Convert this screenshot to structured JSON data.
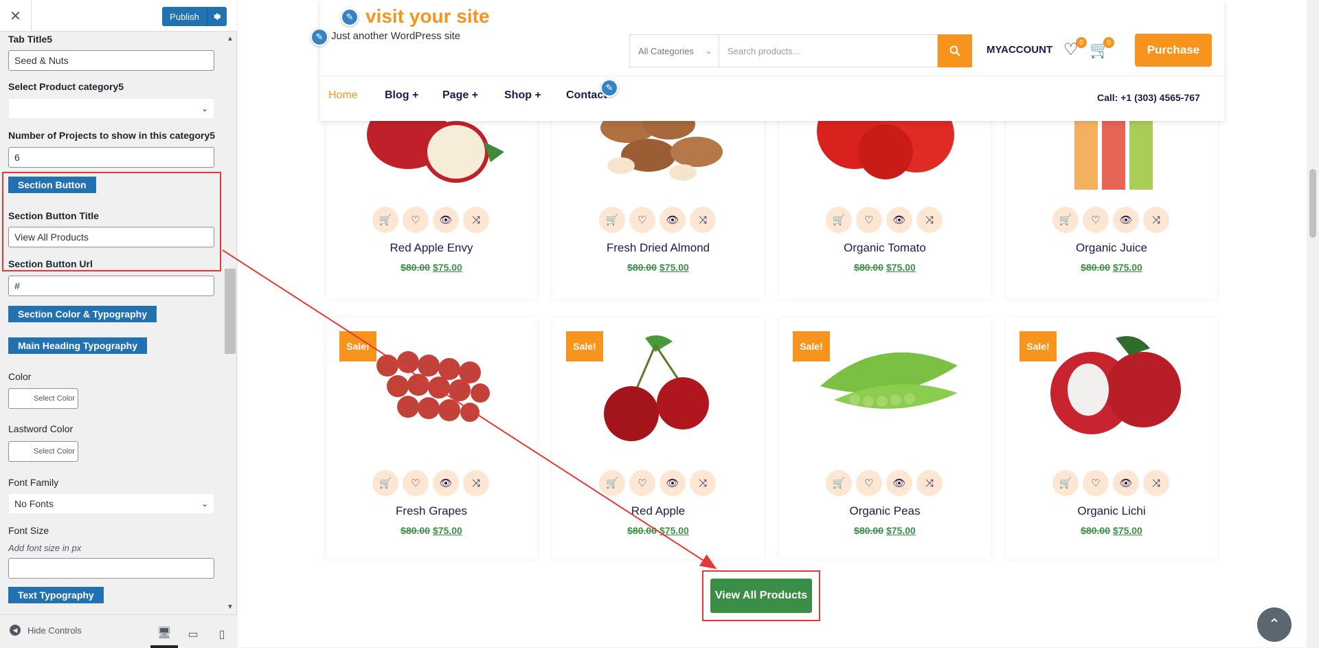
{
  "customizer": {
    "close_glyph": "✕",
    "publish_label": "Publish",
    "tab_title_label": "Tab Title5",
    "tab_title_value": "Seed & Nuts",
    "product_category_label": "Select Product category5",
    "product_category_value": "",
    "projects_count_label": "Number of Projects to show in this category5",
    "projects_count_value": "6",
    "section_button_heading": "Section Button",
    "button_title_label": "Section Button Title",
    "button_title_value": "View All Products",
    "button_url_label": "Section Button Url",
    "button_url_value": "#",
    "color_typography_heading": "Section Color & Typography",
    "main_heading_typography": "Main Heading Typography",
    "color_label": "Color",
    "color_button": "Select Color",
    "lastword_color_label": "Lastword Color",
    "lastword_color_button": "Select Color",
    "font_family_label": "Font Family",
    "font_family_value": "No Fonts",
    "font_size_label": "Font Size",
    "font_size_note": "Add font size in px",
    "font_size_value": "",
    "text_typography_heading": "Text Typography",
    "hide_controls": "Hide Controls"
  },
  "site": {
    "title": "visit your site",
    "tagline": "Just another WordPress site",
    "category_select": "All Categories",
    "search_placeholder": "Search products...",
    "my_account": "MYACCOUNT",
    "wishlist_count": "0",
    "cart_count": "0",
    "purchase": "Purchase",
    "nav": [
      "Home",
      "Blog +",
      "Page +",
      "Shop +",
      "Contact"
    ],
    "call": "Call: +1 (303) 4565-767"
  },
  "products_top": [
    {
      "name": "Red Apple Envy",
      "old": "$80.00",
      "new": "$75.00"
    },
    {
      "name": "Fresh Dried Almond",
      "old": "$80.00",
      "new": "$75.00"
    },
    {
      "name": "Organic Tomato",
      "old": "$80.00",
      "new": "$75.00"
    },
    {
      "name": "Organic Juice",
      "old": "$80.00",
      "new": "$75.00"
    }
  ],
  "products_bottom": [
    {
      "name": "Fresh Grapes",
      "old": "$80.00",
      "new": "$75.00",
      "sale": "Sale!"
    },
    {
      "name": "Red Apple",
      "old": "$80.00",
      "new": "$75.00",
      "sale": "Sale!"
    },
    {
      "name": "Organic Peas",
      "old": "$80.00",
      "new": "$75.00",
      "sale": "Sale!"
    },
    {
      "name": "Organic Lichi",
      "old": "$80.00",
      "new": "$75.00",
      "sale": "Sale!"
    }
  ],
  "view_all": "View All Products",
  "colors": {
    "accent": "#f7941d",
    "green": "#3a8e45",
    "wp_blue": "#2271b1",
    "annotation": "#e53935"
  }
}
